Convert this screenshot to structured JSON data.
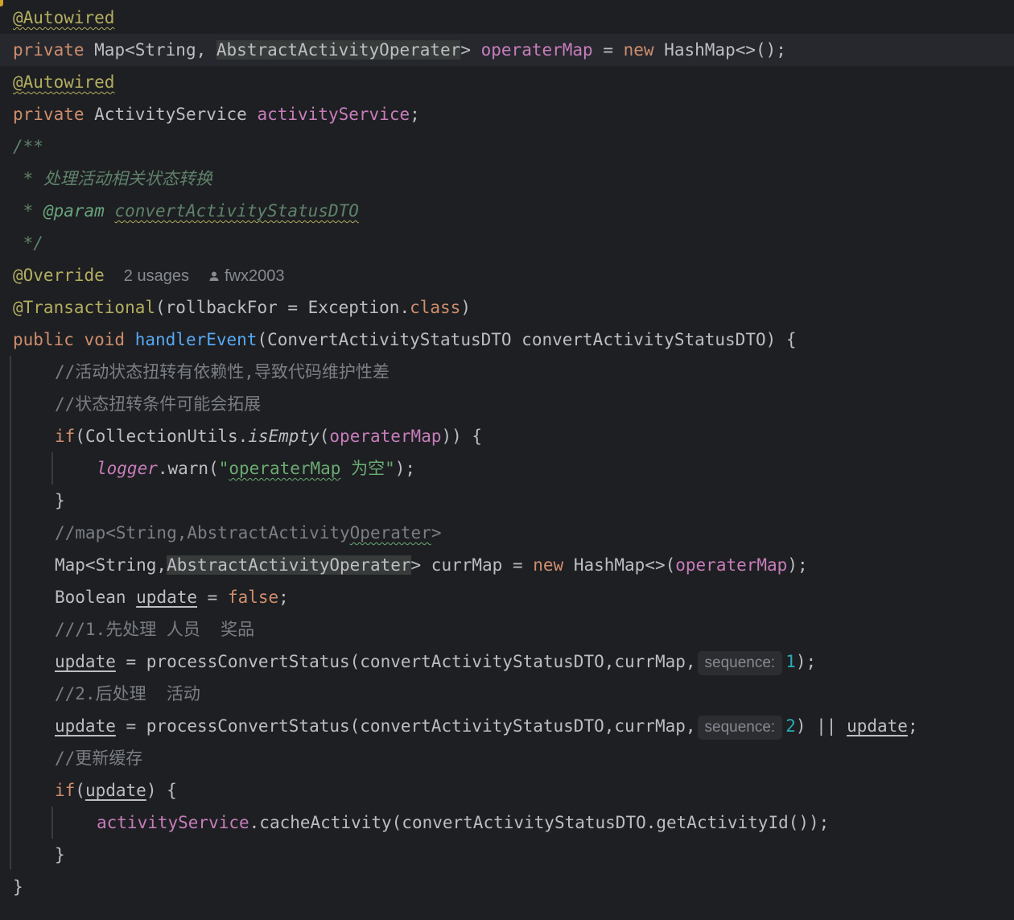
{
  "code": {
    "l1": {
      "ann": "@Autowired"
    },
    "l2": {
      "kw": "private",
      "t1": " Map<String, ",
      "hltype": "AbstractActivityOperater",
      "t2": "> ",
      "fld": "operaterMap",
      "t3": " = ",
      "kw2": "new",
      "t4": " HashMap<>();"
    },
    "l3": {
      "ann": "@Autowired"
    },
    "l4": {
      "kw": "private",
      "t1": " ActivityService ",
      "fld": "activityService",
      "t2": ";"
    },
    "l5": {
      "doc": "/**"
    },
    "l6": {
      "doc": " * 处理活动相关状态转换"
    },
    "l7": {
      "doc": " * ",
      "tag": "@param",
      "sp": " ",
      "param": "convertActivityStatusDTO"
    },
    "l8": {
      "doc": " */"
    },
    "l9": {
      "ann": "@Override",
      "usages": "2 usages",
      "author": "fwx2003"
    },
    "l10": {
      "ann": "@Transactional",
      "t1": "(rollbackFor = Exception.",
      "kw": "class",
      "t2": ")"
    },
    "l11": {
      "kw": "public void",
      "sp": " ",
      "fn": "handlerEvent",
      "t1": "(ConvertActivityStatusDTO convertActivityStatusDTO) {"
    },
    "l12": {
      "cmt": "//活动状态扭转有依赖性,导致代码维护性差"
    },
    "l13": {
      "cmt": "//状态扭转条件可能会拓展"
    },
    "l14": {
      "kw": "if",
      "t1": "(CollectionUtils.",
      "it": "isEmpty",
      "t2": "(",
      "fld": "operaterMap",
      "t3": ")) {"
    },
    "l15": {
      "static": "logger",
      "t1": ".warn(",
      "str1": "\"",
      "strw": "operaterMap",
      "str2": " 为空\"",
      "t2": ");"
    },
    "l16": {
      "t1": "}"
    },
    "l17": {
      "cmt1": "//map<String,AbstractActivity",
      "cmtw": "Operater",
      "cmt2": ">"
    },
    "l18": {
      "t1": "Map<String,",
      "hltype": "AbstractActivityOperater",
      "t2": "> currMap = ",
      "kw": "new",
      "t3": " HashMap<>(",
      "fld": "operaterMap",
      "t4": ");"
    },
    "l19": {
      "t1": "Boolean ",
      "u": "update",
      "t2": " = ",
      "kw": "false",
      "t3": ";"
    },
    "l20": {
      "cmt": "///1.先处理 人员  奖品"
    },
    "l21": {
      "u": "update",
      "t1": " = processConvertStatus(convertActivityStatusDTO,currMap,",
      "hint": "sequence:",
      "num": "1",
      "t2": ");"
    },
    "l22": {
      "cmt": "//2.后处理  活动"
    },
    "l23": {
      "u": "update",
      "t1": " = processConvertStatus(convertActivityStatusDTO,currMap,",
      "hint": "sequence:",
      "num": "2",
      "t2": ") || ",
      "u2": "update",
      "t3": ";"
    },
    "l24": {
      "cmt": "//更新缓存"
    },
    "l25": {
      "kw": "if",
      "t1": "(",
      "u": "update",
      "t2": ") {"
    },
    "l26": {
      "fld": "activityService",
      "t1": ".cacheActivity(convertActivityStatusDTO.getActivityId());"
    },
    "l27": {
      "t1": "}"
    },
    "l28": {
      "t1": "}"
    }
  },
  "colors": {
    "background": "#1e1f22",
    "keyword": "#cf8e6d",
    "annotation": "#b3ae60",
    "field": "#c77dbb",
    "function": "#56a8f5",
    "string": "#6aab73",
    "number": "#2aacb8",
    "comment": "#7a7e85",
    "doc_comment": "#5f826b"
  },
  "icons": {
    "author": "user-icon"
  }
}
